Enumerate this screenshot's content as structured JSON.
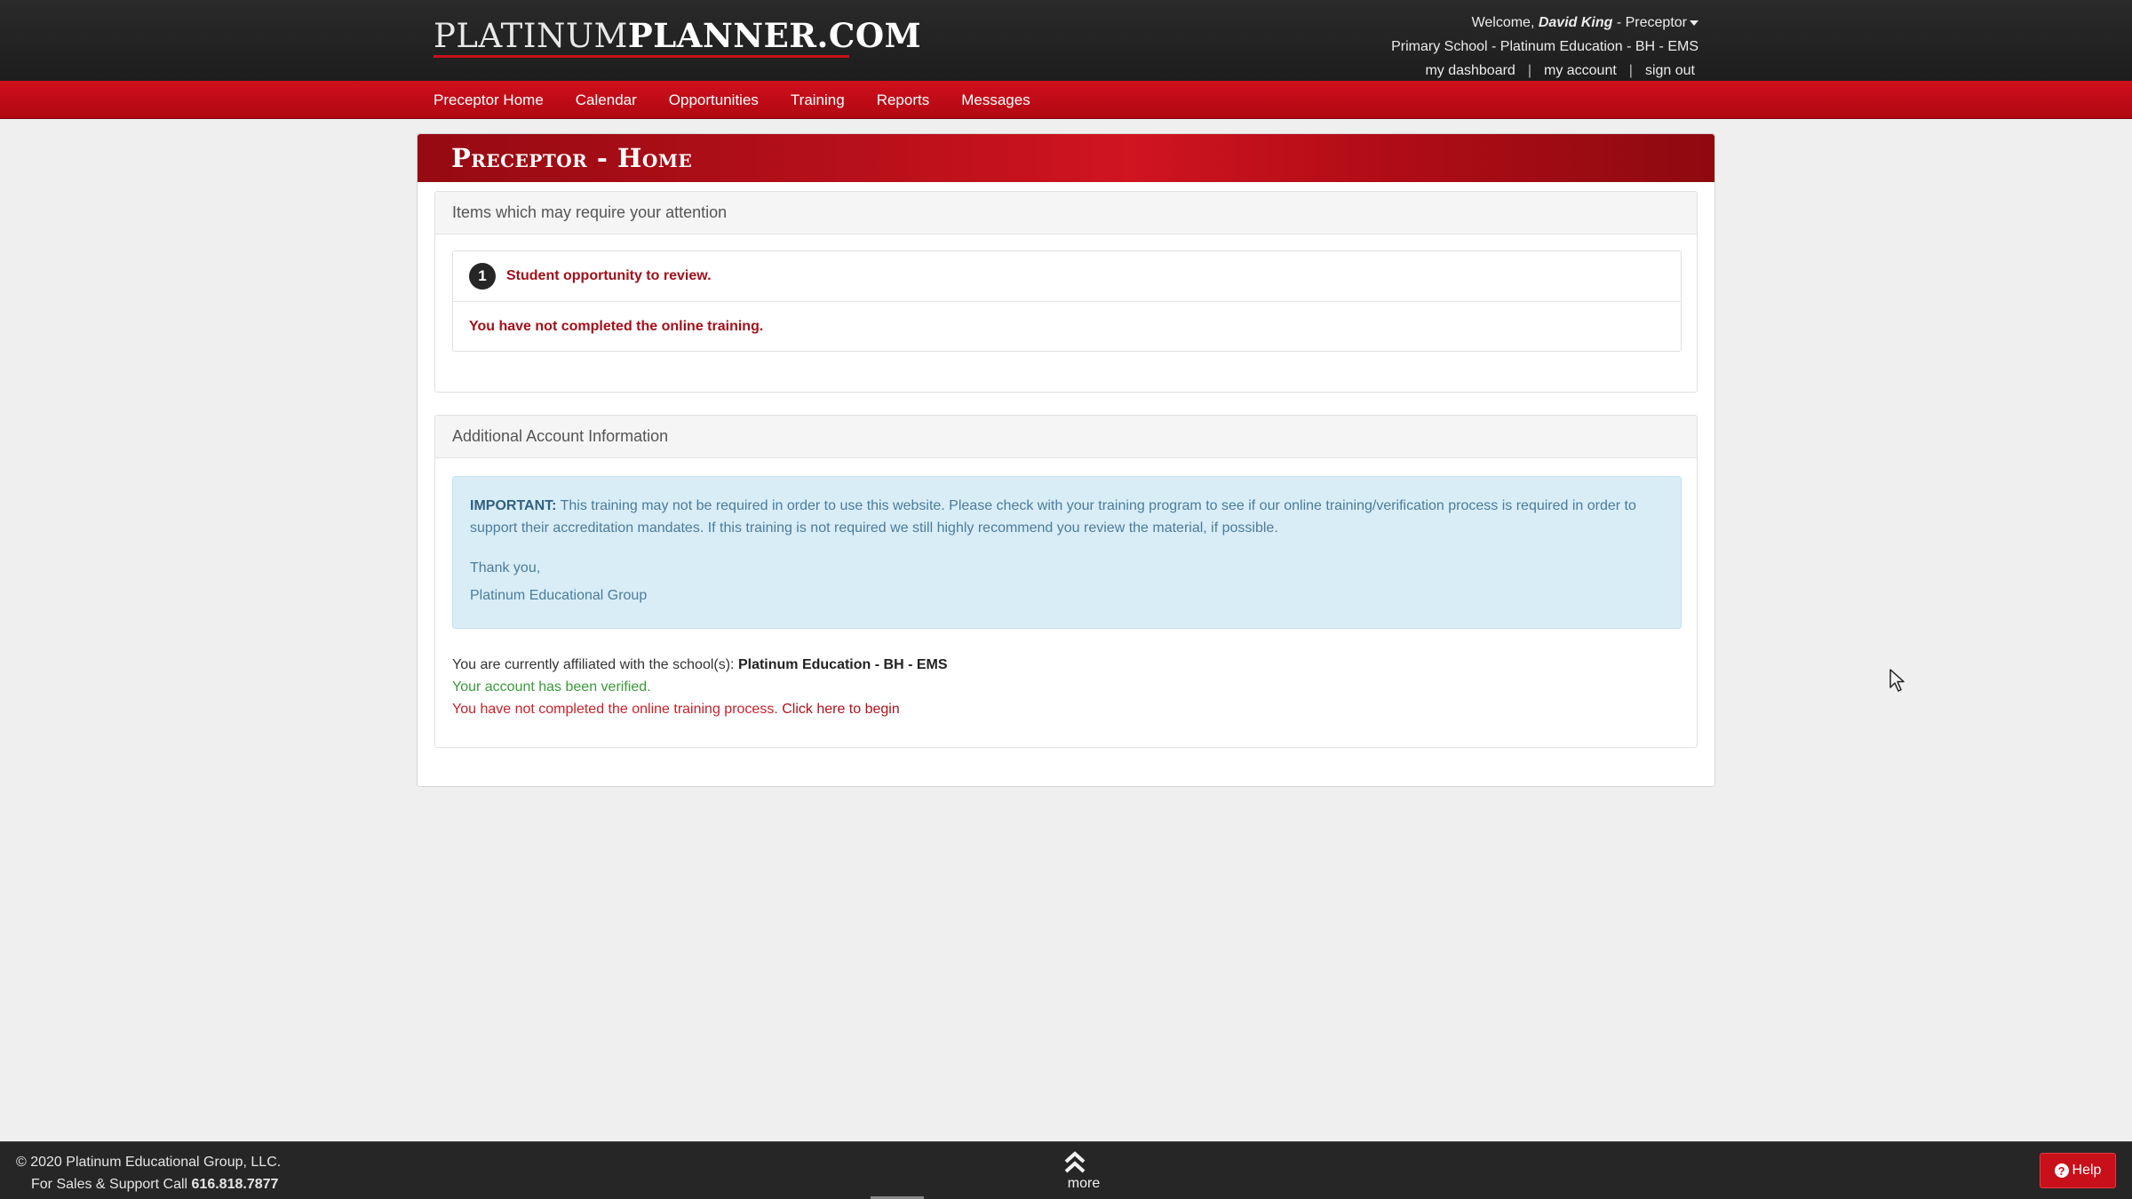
{
  "header": {
    "logo_part1": "PLATINUM",
    "logo_part2": "PLANNER.COM",
    "welcome_prefix": "Welcome, ",
    "user_name": "David King",
    "role_suffix": " - Preceptor",
    "primary_school": "Primary School - Platinum Education - BH - EMS",
    "links": {
      "dashboard": "my dashboard",
      "account": "my account",
      "signout": "sign out"
    },
    "separator": "|"
  },
  "nav": {
    "items": [
      "Preceptor Home",
      "Calendar",
      "Opportunities",
      "Training",
      "Reports",
      "Messages"
    ]
  },
  "page": {
    "title": "Preceptor - Home"
  },
  "attention": {
    "heading": "Items which may require your attention",
    "badge_count": "1",
    "review_text": "Student opportunity to review.",
    "training_text": "You have not completed the online training."
  },
  "account_info": {
    "heading": "Additional Account Information",
    "important_label": "IMPORTANT:",
    "important_text": " This training may not be required in order to use this website. Please check with your training program to see if our online training/verification process is required in order to support their accreditation mandates. If this training is not required we still highly recommend you review the material, if possible.",
    "thanks": "Thank you,",
    "signature": "Platinum Educational Group",
    "affiliation_prefix": "You are currently affiliated with the school(s): ",
    "affiliation_school": "Platinum Education - BH - EMS",
    "verified_text": "Your account has been verified.",
    "training_incomplete": "You have not completed the online training process. ",
    "begin_link": "Click here to begin"
  },
  "footer": {
    "copyright": "© 2020 Platinum Educational Group, LLC.",
    "support_prefix": "For Sales & Support Call ",
    "phone": "616.818.7877",
    "more_label": "more",
    "help_label": "Help"
  },
  "colors": {
    "brand_red": "#c8101a",
    "header_dark": "#262626",
    "info_blue": "#d9edf7",
    "success_green": "#3a9a3a"
  },
  "icons": {
    "more": "double-chevron-up-icon",
    "help": "question-circle-icon",
    "user_menu": "caret-down-icon",
    "cursor": "mouse-pointer-icon"
  }
}
